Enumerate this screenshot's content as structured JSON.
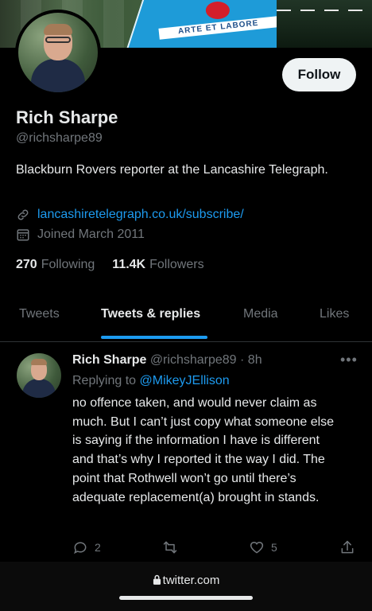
{
  "banner": {
    "crest_motto": "ARTE ET LABORE"
  },
  "profile": {
    "name": "Rich Sharpe",
    "handle": "@richsharpe89",
    "bio": "Blackburn Rovers reporter at the Lancashire Telegraph.",
    "link": "lancashiretelegraph.co.uk/subscribe/",
    "joined": "Joined March 2011",
    "following_count": "270",
    "following_label": "Following",
    "followers_count": "11.4K",
    "followers_label": "Followers",
    "follow_button": "Follow"
  },
  "tabs": [
    {
      "label": "Tweets",
      "active": false
    },
    {
      "label": "Tweets & replies",
      "active": true
    },
    {
      "label": "Media",
      "active": false
    },
    {
      "label": "Likes",
      "active": false
    }
  ],
  "tweet": {
    "author_name": "Rich Sharpe",
    "author_handle": "@richsharpe89",
    "separator": "·",
    "time": "8h",
    "more": "•••",
    "replying_prefix": "Replying to",
    "replying_to": "@MikeyJEllison",
    "text": "no offence taken, and would never claim as much. But I can’t just copy what someone else is saying if the information I have is different and that’s why I reported it the way I did. The point that Rothwell won’t go until there’s adequate replacement(a) brought in stands.",
    "reply_count": "2",
    "retweet_count": "",
    "like_count": "5"
  },
  "browser": {
    "url": "twitter.com"
  },
  "colors": {
    "accent": "#1d9bf0",
    "background": "#000000",
    "muted": "#71767b",
    "text": "#e7e9ea"
  }
}
